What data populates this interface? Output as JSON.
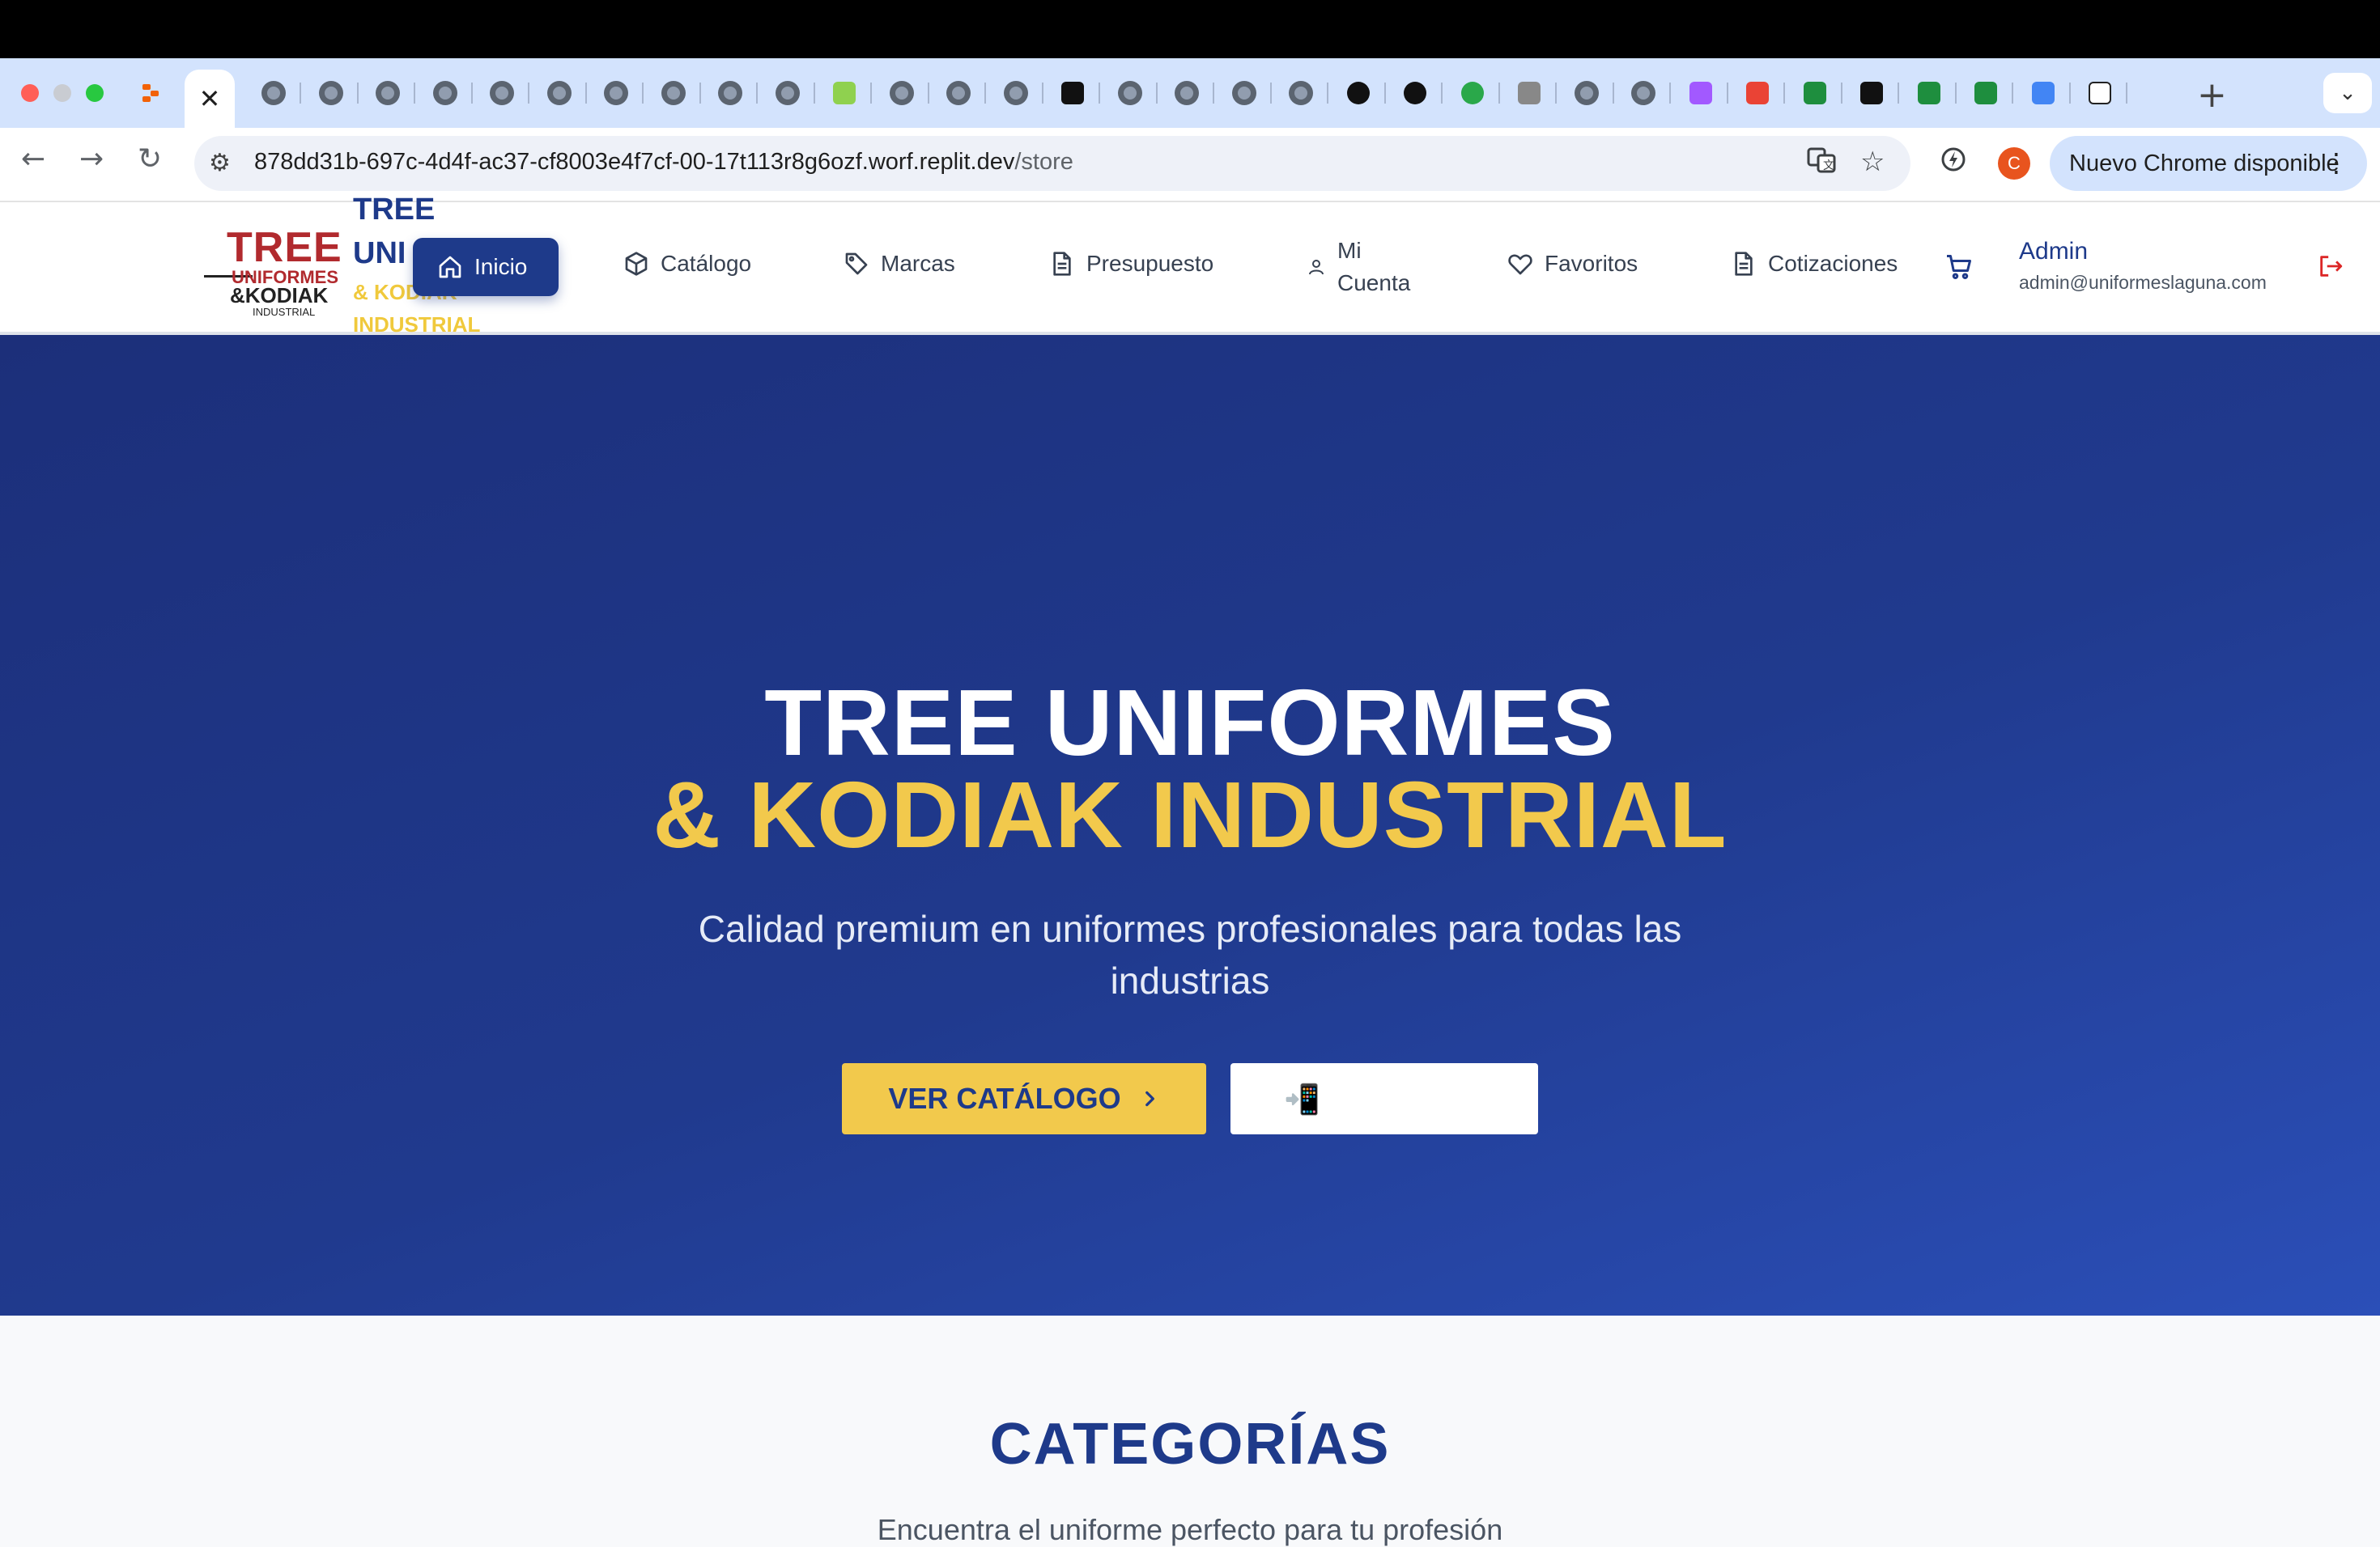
{
  "browser": {
    "active_tab_close": "✕",
    "new_tab": "+",
    "tab_menu": "⌄",
    "url_host": "878dd31b-697c-4d4f-ac37-cf8003e4f7cf-00-17t113r8g6ozf.worf.replit.dev",
    "url_path": "/store",
    "profile_initial": "C",
    "update_label": "Nuevo Chrome disponible",
    "tab_icons": [
      "replit-icon",
      "globe-icon",
      "globe-icon",
      "globe-icon",
      "globe-icon",
      "globe-icon",
      "globe-icon",
      "globe-icon",
      "globe-icon",
      "globe-icon",
      "globe-icon",
      "app-icon",
      "globe-icon",
      "globe-icon",
      "globe-icon",
      "apify-icon",
      "globe-icon",
      "globe-icon",
      "globe-icon",
      "globe-icon",
      "github-icon",
      "github-icon",
      "onepassword-icon",
      "doc-icon",
      "globe-icon",
      "globe-icon",
      "figma-icon",
      "gmail-icon",
      "sheets-icon",
      "apify-icon",
      "sheets-icon",
      "sheets-icon",
      "docs-icon",
      "amazon-icon"
    ]
  },
  "header": {
    "logo": {
      "line1": "TREE",
      "line2": "UNIFORMES",
      "line3": "&KODIAK",
      "line4": "INDUSTRIAL"
    },
    "brand": {
      "a": "TREE",
      "b": "UNI",
      "c": "& KODIAK",
      "d": "INDUSTRIAL"
    },
    "nav": {
      "inicio": "Inicio",
      "catalogo": "Catálogo",
      "marcas": "Marcas",
      "presupuesto": "Presupuesto",
      "mi": "Mi",
      "cuenta": "Cuenta",
      "favoritos": "Favoritos",
      "cotizaciones": "Cotizaciones"
    },
    "user": {
      "name": "Admin",
      "email": "admin@uniformeslaguna.com"
    }
  },
  "hero": {
    "title_line1": "TREE UNIFORMES",
    "title_line2": "& KODIAK INDUSTRIAL",
    "subtitle": "Calidad premium en uniformes profesionales para todas las industrias",
    "cta_catalog": "VER CATÁLOGO",
    "cta_app_icon": "📲"
  },
  "categories": {
    "title": "CATEGORÍAS",
    "subtitle": "Encuentra el uniforme perfecto para tu profesión"
  },
  "colors": {
    "brand_blue": "#1e3a8a",
    "brand_yellow": "#f2c94c",
    "logo_red": "#b12a2e",
    "chrome_tab_bg": "#d3e3fd"
  }
}
